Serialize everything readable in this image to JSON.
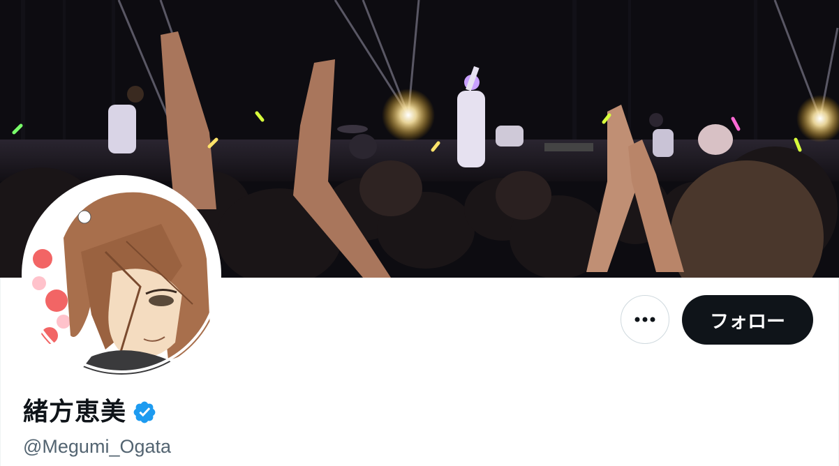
{
  "profile": {
    "display_name": "緒方恵美",
    "handle": "@Megumi_Ogata",
    "verified": true,
    "banner_image": "concert-crowd-photo",
    "avatar_image": "anime-style-illustrated-portrait"
  },
  "actions": {
    "more_icon": "ellipsis-icon",
    "follow_label": "フォロー"
  },
  "colors": {
    "text_primary": "#0f1419",
    "text_secondary": "#536471",
    "follow_bg": "#0f1419",
    "verified_blue": "#1d9bf0",
    "border": "#cfd9de"
  }
}
